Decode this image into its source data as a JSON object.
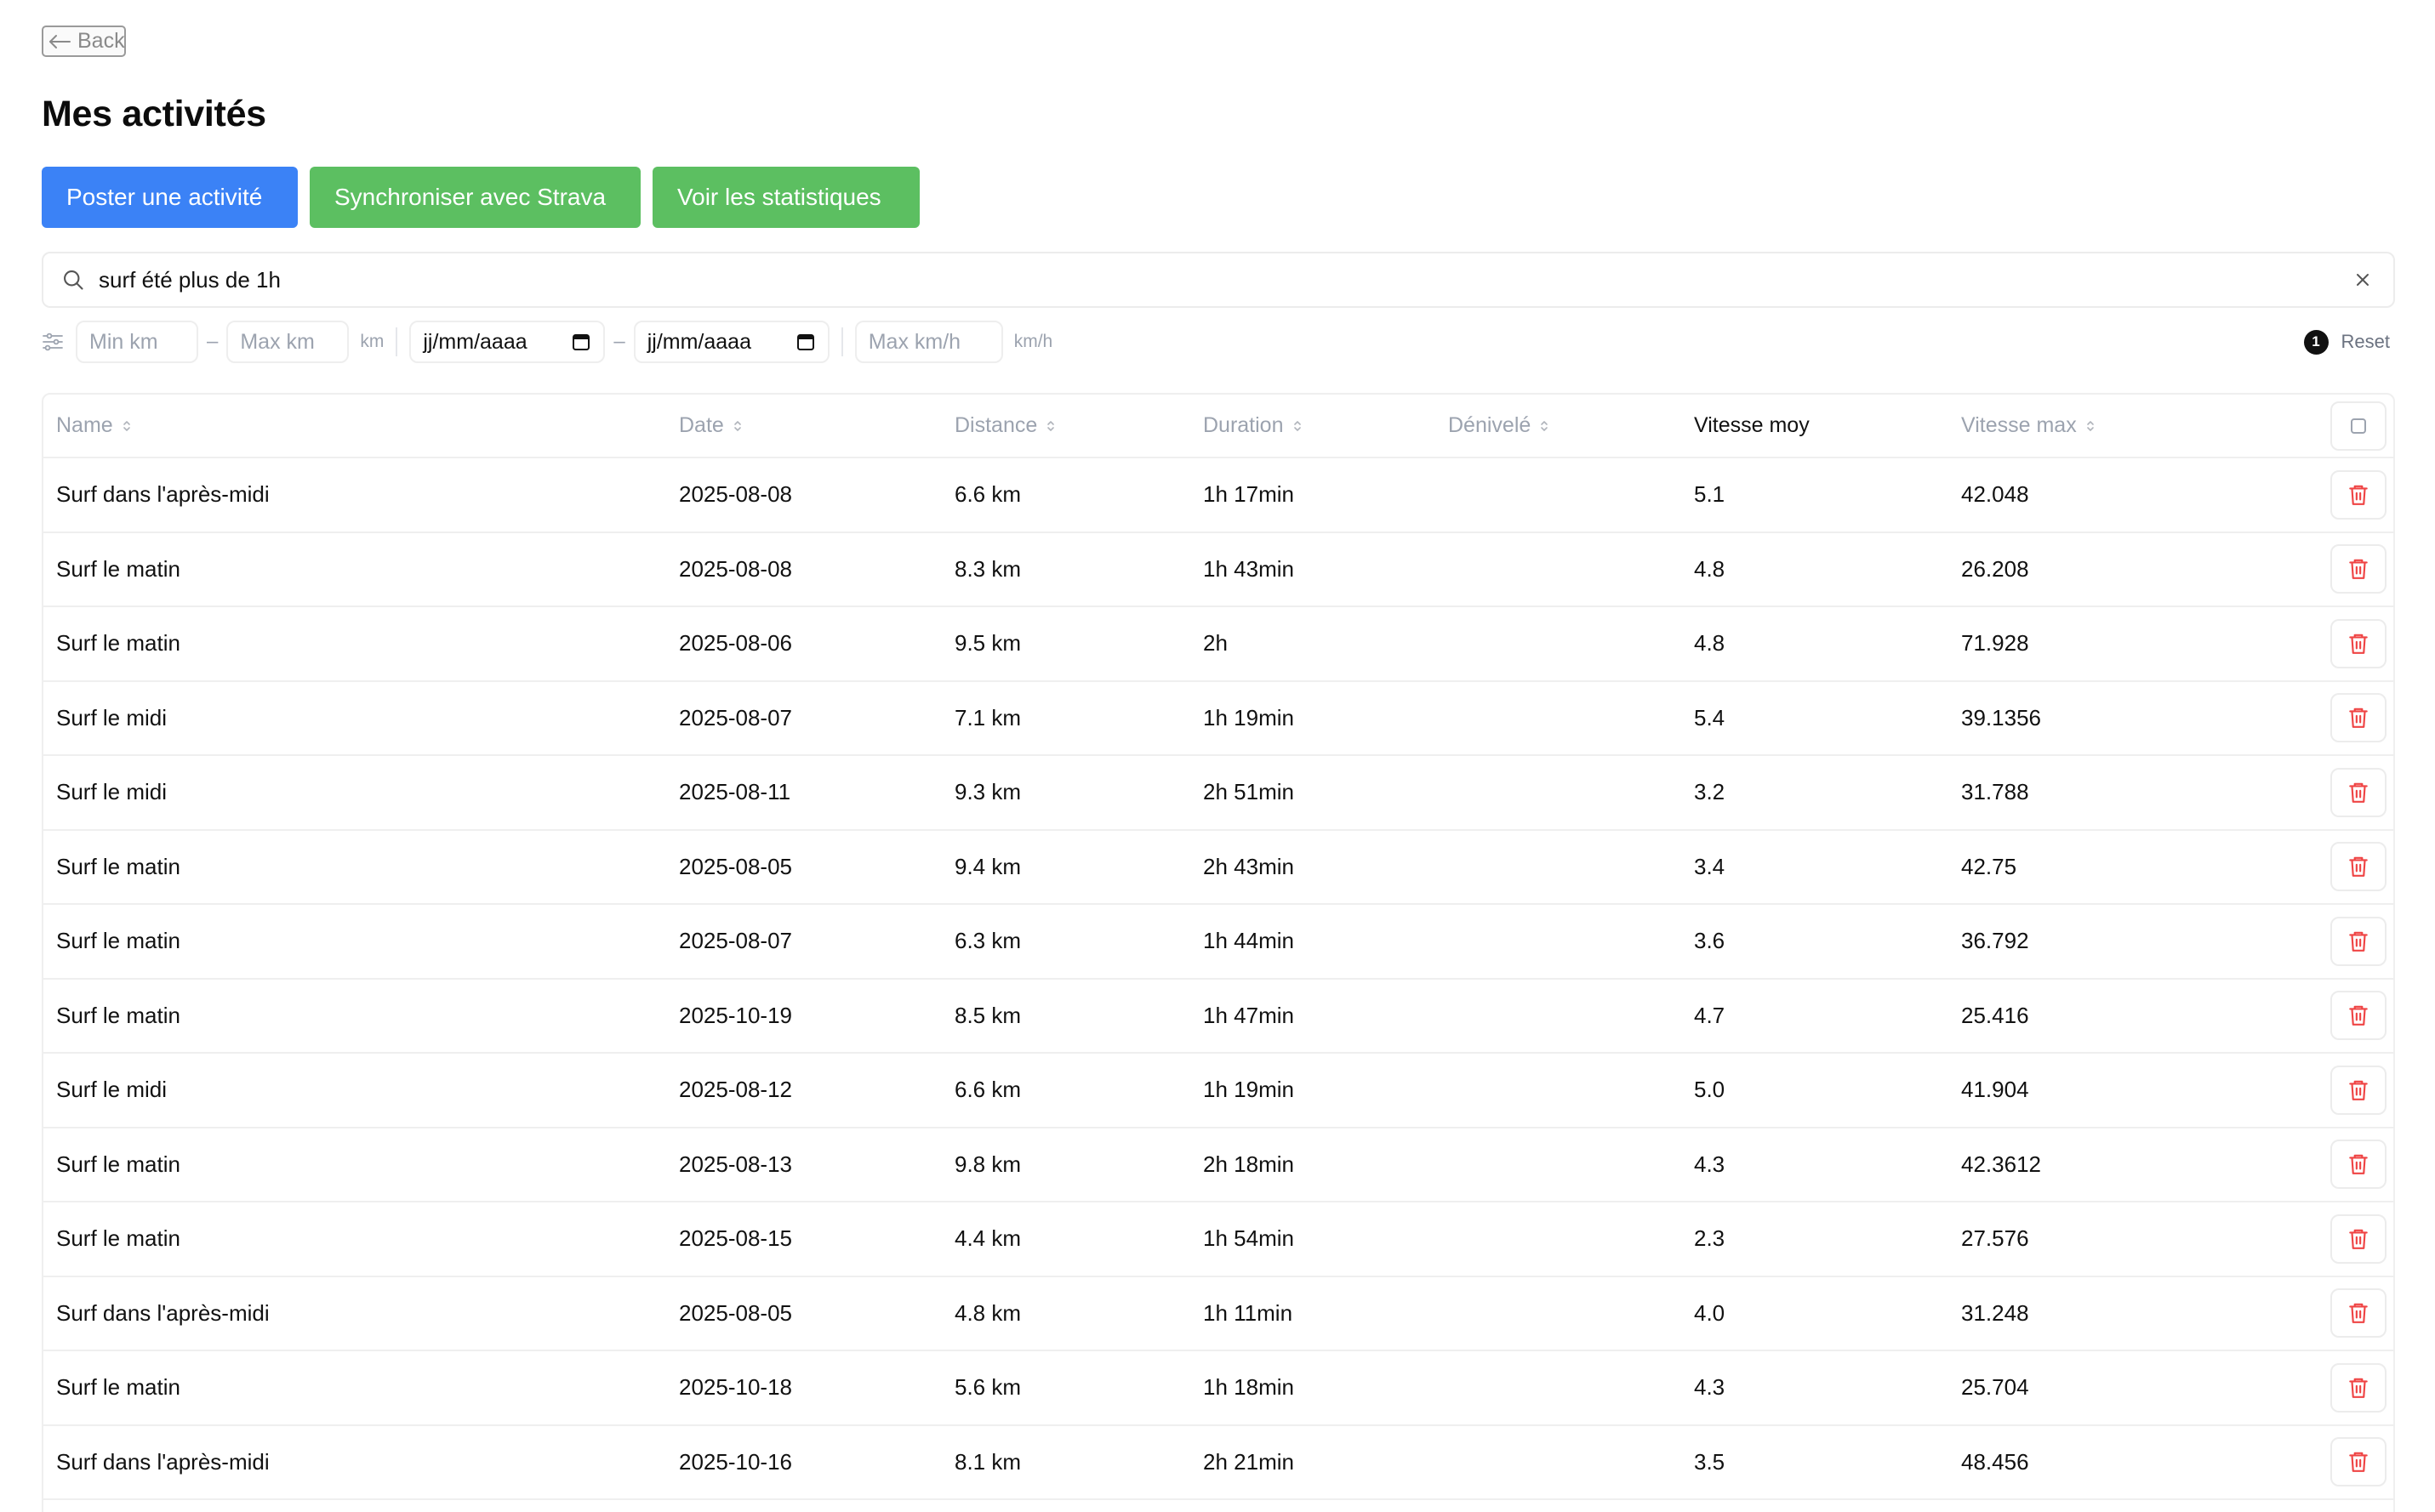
{
  "nav": {
    "back_label": "Back"
  },
  "page": {
    "title": "Mes activités"
  },
  "actions": {
    "post": "Poster une activité",
    "sync": "Synchroniser avec Strava",
    "stats": "Voir les statistiques"
  },
  "search": {
    "value": "surf été plus de 1h"
  },
  "filters": {
    "min_km_placeholder": "Min km",
    "max_km_placeholder": "Max km",
    "km_unit": "km",
    "date_from_placeholder": "jj/mm/aaaa",
    "date_to_placeholder": "jj/mm/aaaa",
    "dash": "–",
    "max_speed_placeholder": "Max km/h",
    "speed_unit": "km/h",
    "active_count": "1",
    "reset_label": "Reset"
  },
  "table": {
    "columns": {
      "name": "Name",
      "date": "Date",
      "distance": "Distance",
      "duration": "Duration",
      "elevation": "Dénivelé",
      "avg_speed": "Vitesse moy",
      "max_speed": "Vitesse max"
    },
    "rows": [
      {
        "name": "Surf dans l'après-midi",
        "date": "2025-08-08",
        "distance": "6.6 km",
        "duration": "1h 17min",
        "elevation": "",
        "avg": "5.1",
        "max": "42.048"
      },
      {
        "name": "Surf le matin",
        "date": "2025-08-08",
        "distance": "8.3 km",
        "duration": "1h 43min",
        "elevation": "",
        "avg": "4.8",
        "max": "26.208"
      },
      {
        "name": "Surf le matin",
        "date": "2025-08-06",
        "distance": "9.5 km",
        "duration": "2h",
        "elevation": "",
        "avg": "4.8",
        "max": "71.928"
      },
      {
        "name": "Surf le midi",
        "date": "2025-08-07",
        "distance": "7.1 km",
        "duration": "1h 19min",
        "elevation": "",
        "avg": "5.4",
        "max": "39.1356"
      },
      {
        "name": "Surf le midi",
        "date": "2025-08-11",
        "distance": "9.3 km",
        "duration": "2h 51min",
        "elevation": "",
        "avg": "3.2",
        "max": "31.788"
      },
      {
        "name": "Surf le matin",
        "date": "2025-08-05",
        "distance": "9.4 km",
        "duration": "2h 43min",
        "elevation": "",
        "avg": "3.4",
        "max": "42.75"
      },
      {
        "name": "Surf le matin",
        "date": "2025-08-07",
        "distance": "6.3 km",
        "duration": "1h 44min",
        "elevation": "",
        "avg": "3.6",
        "max": "36.792"
      },
      {
        "name": "Surf le matin",
        "date": "2025-10-19",
        "distance": "8.5 km",
        "duration": "1h 47min",
        "elevation": "",
        "avg": "4.7",
        "max": "25.416"
      },
      {
        "name": "Surf le midi",
        "date": "2025-08-12",
        "distance": "6.6 km",
        "duration": "1h 19min",
        "elevation": "",
        "avg": "5.0",
        "max": "41.904"
      },
      {
        "name": "Surf le matin",
        "date": "2025-08-13",
        "distance": "9.8 km",
        "duration": "2h 18min",
        "elevation": "",
        "avg": "4.3",
        "max": "42.3612"
      },
      {
        "name": "Surf le matin",
        "date": "2025-08-15",
        "distance": "4.4 km",
        "duration": "1h 54min",
        "elevation": "",
        "avg": "2.3",
        "max": "27.576"
      },
      {
        "name": "Surf dans l'après-midi",
        "date": "2025-08-05",
        "distance": "4.8 km",
        "duration": "1h 11min",
        "elevation": "",
        "avg": "4.0",
        "max": "31.248"
      },
      {
        "name": "Surf le matin",
        "date": "2025-10-18",
        "distance": "5.6 km",
        "duration": "1h 18min",
        "elevation": "",
        "avg": "4.3",
        "max": "25.704"
      },
      {
        "name": "Surf dans l'après-midi",
        "date": "2025-10-16",
        "distance": "8.1 km",
        "duration": "2h 21min",
        "elevation": "",
        "avg": "3.5",
        "max": "48.456"
      },
      {
        "name": "",
        "date": "",
        "distance": "",
        "duration": "",
        "elevation": "",
        "avg": "",
        "max": ""
      }
    ]
  }
}
